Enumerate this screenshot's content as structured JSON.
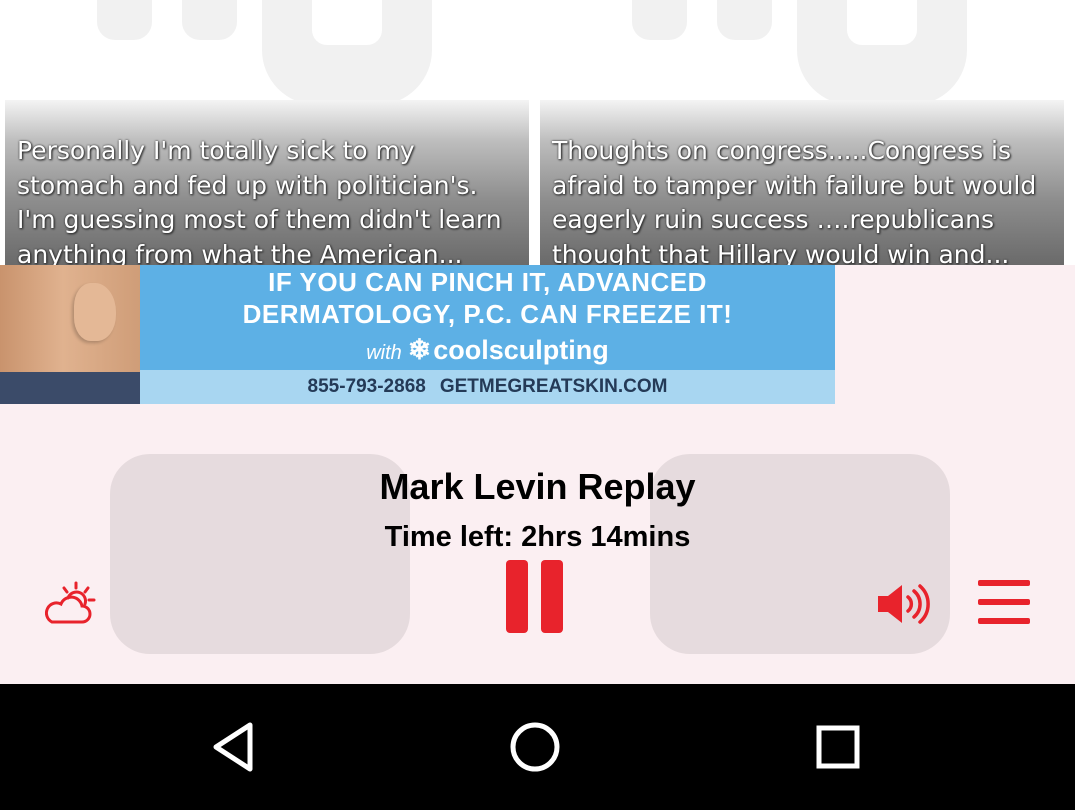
{
  "feed": {
    "cards": [
      {
        "caption": "Personally I'm totally sick to my stomach and fed up with politician's. I'm guessing most of them didn't learn anything from what the American..."
      },
      {
        "caption": "Thoughts on congress.....Congress is afraid to tamper with failure but would eagerly ruin success ….republicans thought that Hillary would win and..."
      }
    ]
  },
  "ad": {
    "line1": "IF YOU CAN PINCH IT, ADVANCED",
    "line2": "DERMATOLOGY, P.C. CAN FREEZE IT!",
    "with_text": "with",
    "brand": "coolsculpting",
    "phone": "855-793-2868",
    "website": "GETMEGREATSKIN.COM",
    "colors": {
      "background": "#5db0e5",
      "strip": "#a8d6f1"
    }
  },
  "player": {
    "title": "Mark Levin Replay",
    "time_left": "Time left: 2hrs 14mins",
    "accent_color": "#e8232c",
    "icons": [
      "weather-icon",
      "pause-icon",
      "volume-icon",
      "menu-icon"
    ]
  },
  "navbar": {
    "icons": [
      "back-icon",
      "home-icon",
      "recent-apps-icon"
    ]
  }
}
